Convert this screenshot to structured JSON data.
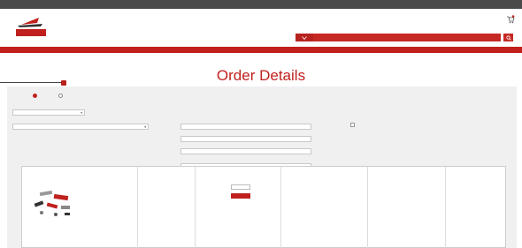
{
  "topbar": {
    "left_text": "",
    "right_text": ""
  },
  "header": {
    "logo_alt": "",
    "links": [
      "",
      "",
      "",
      ""
    ],
    "search_select": "",
    "search_placeholder": ""
  },
  "nav": {
    "items": [
      "",
      ""
    ]
  },
  "breadcrumb": "",
  "page_title": "Order Details",
  "form": {
    "order_type_label": "",
    "order_type_options": [
      "",
      ""
    ],
    "order_type_selected": 0,
    "field_a_label": "",
    "field_a_value": "",
    "field_b_label": "",
    "field_b_value": "",
    "field_c_label": "",
    "field_c_value": "",
    "field_c2_value": "",
    "field_d_label": "",
    "field_d_value": "",
    "checkbox_label": ""
  },
  "table": {
    "headers": [
      "",
      "",
      "",
      "",
      "",
      ""
    ],
    "rows": [
      {
        "sku": "",
        "description": "",
        "unit_price": "",
        "qty": "",
        "update_label": "",
        "available": "",
        "extended": "",
        "remove_label": ""
      }
    ]
  },
  "colors": {
    "brand_red": "#c0211e",
    "topbar_gray": "#4a4a4a",
    "panel_gray": "#f0f0f0"
  }
}
